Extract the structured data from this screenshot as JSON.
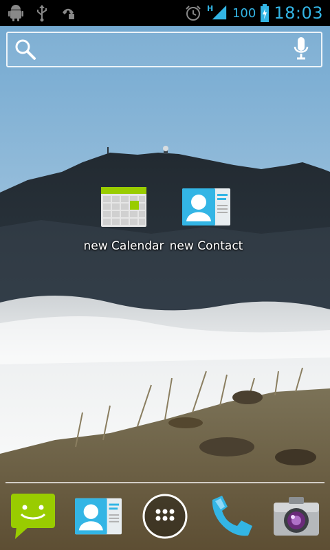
{
  "status_bar": {
    "left_icons": [
      "android-debug-icon",
      "usb-icon",
      "call-forward-icon"
    ],
    "network_type": "H",
    "battery_level": "100",
    "time": "18:03",
    "accent_color": "#33b5e5"
  },
  "search": {
    "search_icon": "search-icon",
    "voice_icon": "microphone-icon"
  },
  "home_shortcuts": [
    {
      "label": "new Calendar",
      "icon": "calendar-icon"
    },
    {
      "label": "new Contact",
      "icon": "contact-card-icon"
    }
  ],
  "dock": [
    {
      "icon": "messaging-icon"
    },
    {
      "icon": "contacts-icon"
    },
    {
      "icon": "app-drawer-icon"
    },
    {
      "icon": "phone-icon"
    },
    {
      "icon": "camera-icon"
    }
  ]
}
